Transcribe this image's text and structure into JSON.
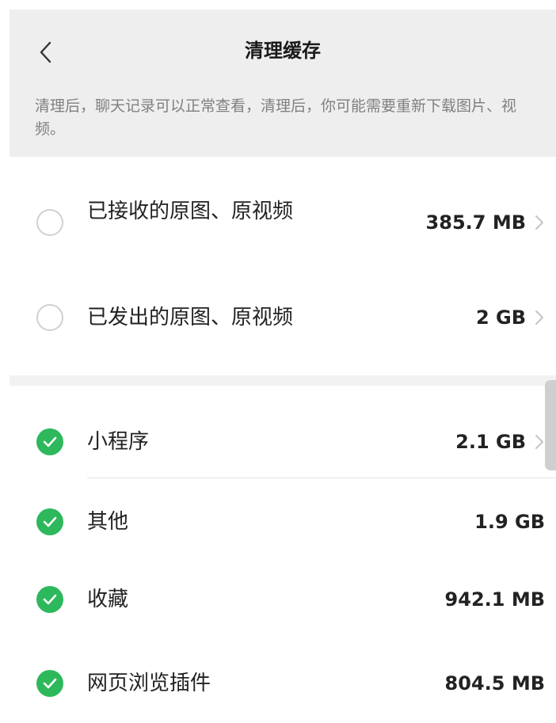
{
  "header": {
    "title": "清理缓存",
    "description": "清理后，聊天记录可以正常查看，清理后，你可能需要重新下载图片、视频。"
  },
  "sections": [
    {
      "items": [
        {
          "label": "已接收的原图、原视频",
          "size": "385.7 MB",
          "checked": false,
          "has_arrow": true
        },
        {
          "label": "已发出的原图、原视频",
          "size": "2 GB",
          "checked": false,
          "has_arrow": true
        }
      ]
    },
    {
      "items": [
        {
          "label": "小程序",
          "size": "2.1 GB",
          "checked": true,
          "has_arrow": true
        },
        {
          "label": "其他",
          "size": "1.9 GB",
          "checked": true,
          "has_arrow": false
        },
        {
          "label": "收藏",
          "size": "942.1 MB",
          "checked": true,
          "has_arrow": false
        },
        {
          "label": "网页浏览插件",
          "size": "804.5 MB",
          "checked": true,
          "has_arrow": false
        }
      ]
    }
  ],
  "colors": {
    "accent_green": "#2db85c",
    "header_bg": "#eeeeee",
    "section_gap_bg": "#f2f2f2"
  },
  "icons": {
    "back": "chevron-left-icon",
    "row_arrow": "chevron-right-icon",
    "checked": "check-circle-icon",
    "unchecked": "empty-circle-icon"
  }
}
